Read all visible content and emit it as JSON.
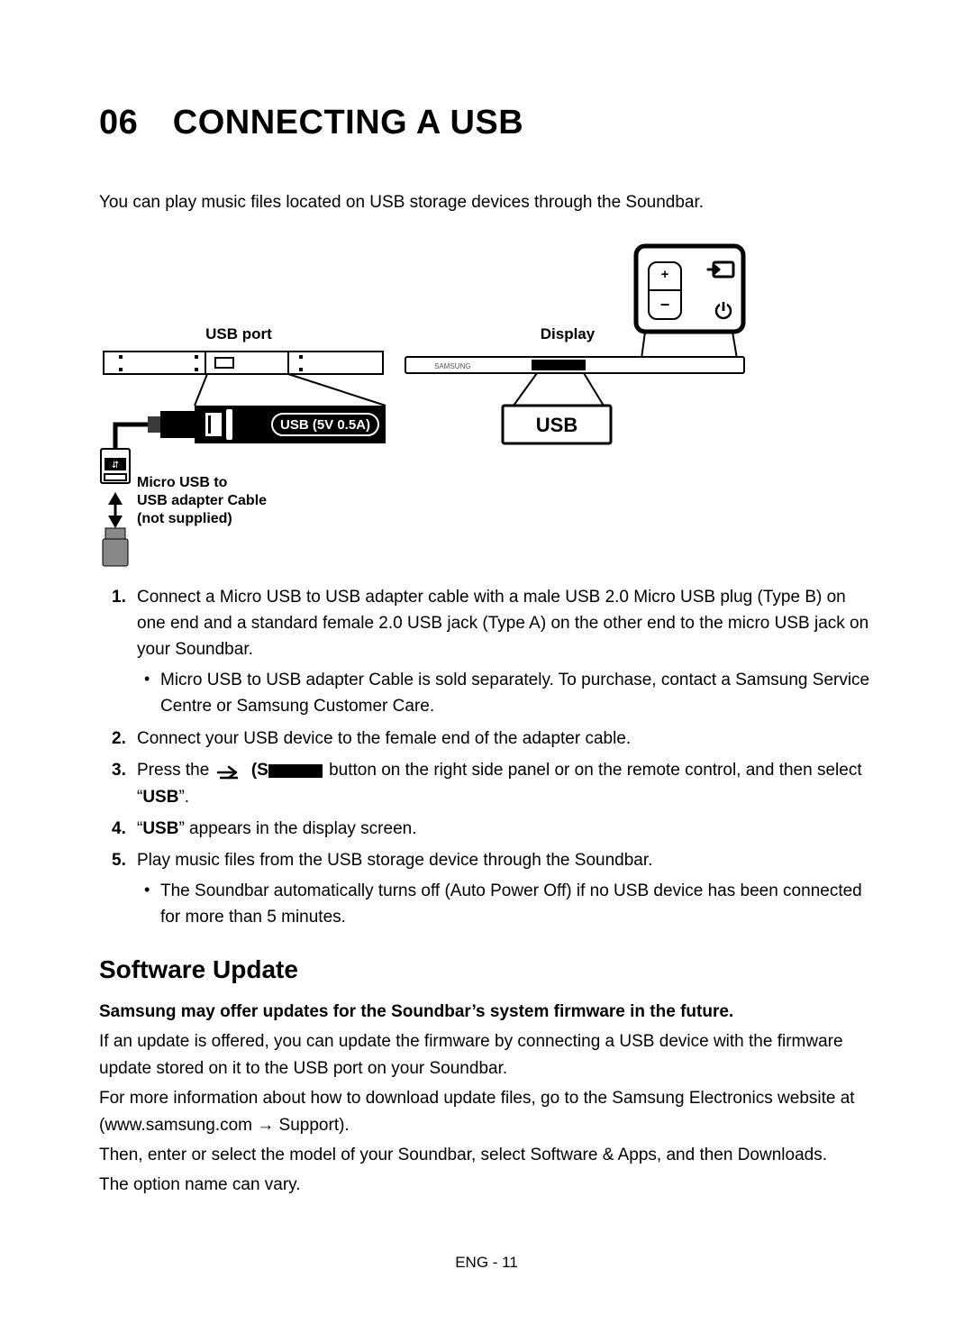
{
  "title": "06 CONNECTING A USB",
  "intro": "You can play music files located on USB storage devices through the Soundbar.",
  "diagram": {
    "usb_port_label": "USB port",
    "display_label": "Display",
    "port_badge": "USB (5V 0.5A)",
    "display_word": "USB",
    "cable_caption_l1": "Micro USB to",
    "cable_caption_l2": "USB adapter Cable",
    "cable_caption_l3": "(not supplied)"
  },
  "steps": [
    {
      "text": "Connect a Micro USB to USB adapter cable with a male USB 2.0 Micro USB plug (Type B) on one end and a standard female 2.0 USB jack (Type A) on the other end to the micro USB jack on your Soundbar.",
      "sub": [
        "Micro USB to USB adapter Cable is sold separately. To purchase, contact a Samsung Service Centre or Samsung Customer Care."
      ]
    },
    {
      "text": "Connect your USB device to the female end of the adapter cable."
    },
    {
      "pre": "Press the ",
      "after_icon": " (S",
      "post": "button on the right side panel or on the remote control, and then select “",
      "bold_word": "USB",
      "close": "”."
    },
    {
      "pre": "“",
      "bold_word": "USB",
      "post": "” appears in the display screen."
    },
    {
      "text": "Play music files from the USB storage device through the Soundbar.",
      "sub": [
        "The Soundbar automatically turns off (Auto Power Off) if no USB device has been connected for more than 5 minutes."
      ]
    }
  ],
  "subheading": "Software Update",
  "update_bold": "Samsung may offer updates for the Soundbar’s system firmware in the future.",
  "update_p1": "If an update is offered, you can update the firmware by connecting a USB device with the firmware update stored on it to the USB port on your Soundbar.",
  "update_p2_pre": "For more information about how to download update files, go to the Samsung Electronics website at (www.samsung.com ",
  "update_p2_arrow": "→",
  "update_p2_post": " Support).",
  "update_p3": "Then, enter or select the model of your Soundbar, select Software & Apps, and then Downloads.",
  "update_p4": "The option name can vary.",
  "footer": "ENG - 11"
}
